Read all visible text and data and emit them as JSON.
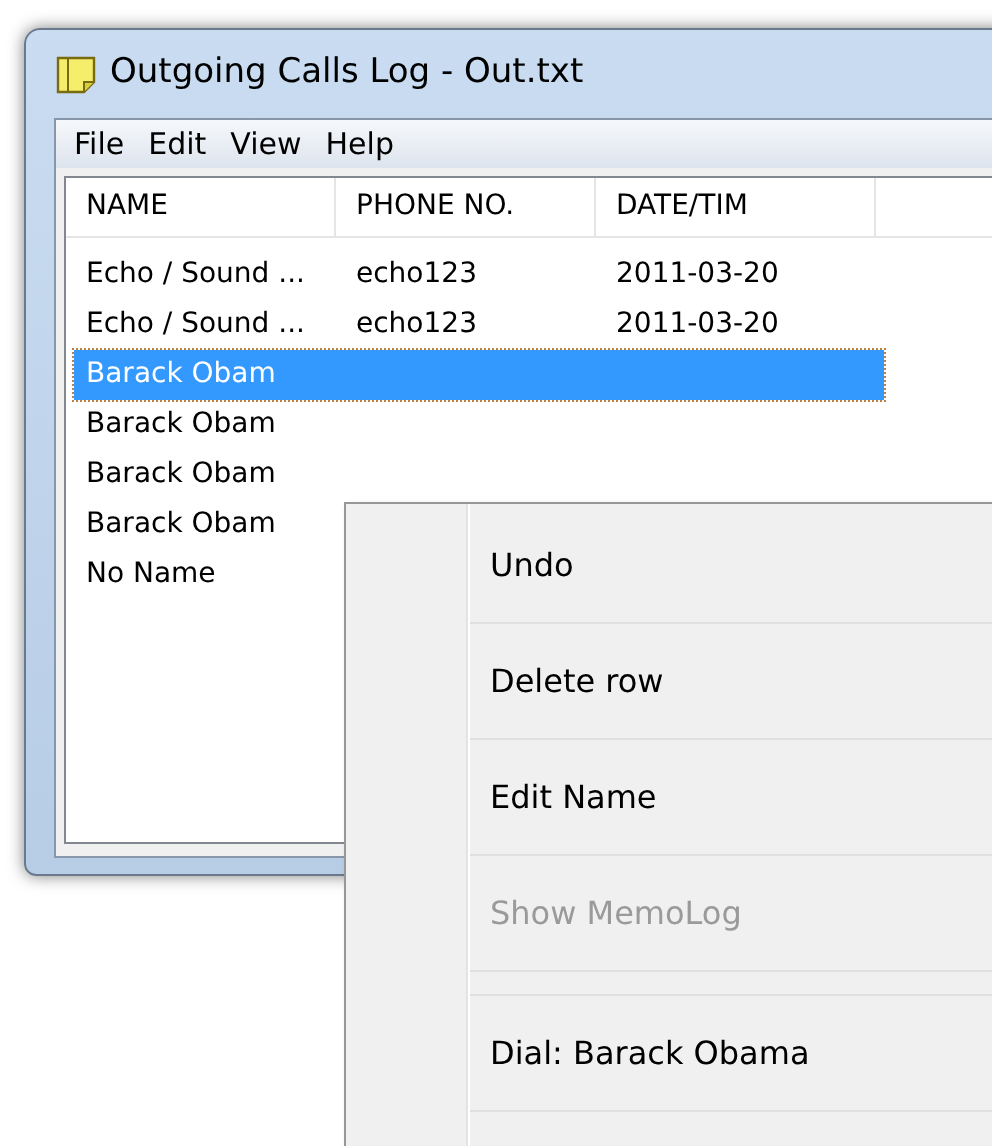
{
  "window": {
    "title": "Outgoing Calls Log - Out.txt"
  },
  "menu_bar": [
    "File",
    "Edit",
    "View",
    "Help"
  ],
  "table": {
    "columns": [
      "NAME",
      "PHONE NO.",
      "DATE/TIM"
    ],
    "rows": [
      {
        "cells": [
          "Echo / Sound ...",
          "echo123",
          "2011-03-20"
        ],
        "selected": false
      },
      {
        "cells": [
          "Echo / Sound ...",
          "echo123",
          "2011-03-20"
        ],
        "selected": false
      },
      {
        "cells": [
          "Barack Obam"
        ],
        "selected": true
      },
      {
        "cells": [
          "Barack Obam"
        ],
        "selected": false
      },
      {
        "cells": [
          "Barack Obam"
        ],
        "selected": false
      },
      {
        "cells": [
          "Barack Obam"
        ],
        "selected": false
      },
      {
        "cells": [
          "No Name"
        ],
        "selected": false
      }
    ]
  },
  "context_menu": [
    {
      "kind": "item",
      "label": "Undo",
      "disabled": false
    },
    {
      "kind": "item",
      "label": "Delete row",
      "disabled": false
    },
    {
      "kind": "item",
      "label": "Edit Name",
      "disabled": false
    },
    {
      "kind": "item",
      "label": "Show MemoLog",
      "disabled": true
    },
    {
      "kind": "separator"
    },
    {
      "kind": "item",
      "label": "Dial: Barack Obama",
      "disabled": false
    }
  ]
}
